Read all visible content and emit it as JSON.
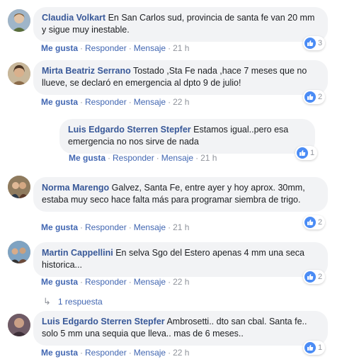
{
  "comments": [
    {
      "author": "Claudia Volkart",
      "text": "En San Carlos sud, provincia de santa fe van 20 mm y sigue muy inestable.",
      "like": "Me gusta",
      "reply": "Responder",
      "message": "Mensaje",
      "time": "21 h",
      "reactions": "3"
    },
    {
      "author": "Mirta Beatriz Serrano",
      "text": "Tostado ,Sta Fe nada ,hace 7 meses que no llueve, se declaró en emergencia al dpto 9 de julio!",
      "like": "Me gusta",
      "reply": "Responder",
      "message": "Mensaje",
      "time": "22 h",
      "reactions": "2"
    },
    {
      "author": "Luis Edgardo Sterren Stepfer",
      "text": "Estamos igual..pero esa emergencia no nos sirve de nada",
      "like": "Me gusta",
      "reply": "Responder",
      "message": "Mensaje",
      "time": "21 h",
      "reactions": "1"
    },
    {
      "author": "Norma Marengo",
      "text": "Galvez, Santa Fe, entre ayer y hoy aprox. 30mm, estaba muy seco hace falta más para programar siembra de trigo.",
      "like": "Me gusta",
      "reply": "Responder",
      "message": "Mensaje",
      "time": "21 h",
      "reactions": "2"
    },
    {
      "author": "Martin Cappellini",
      "text": "En selva Sgo del Estero apenas 4 mm una seca historica...",
      "like": "Me gusta",
      "reply": "Responder",
      "message": "Mensaje",
      "time": "22 h",
      "reactions": "2",
      "replies_label": "1 respuesta"
    },
    {
      "author": "Luis Edgardo Sterren Stepfer",
      "text": "Ambrosetti.. dto san cbal. Santa fe.. solo 5 mm una sequia que lleva.. mas de 6 meses..",
      "like": "Me gusta",
      "reply": "Responder",
      "message": "Mensaje",
      "time": "22 h",
      "reactions": "1"
    }
  ],
  "colors": {
    "author": "#385898",
    "action": "#4267b2",
    "bubble": "#f2f3f5",
    "meta": "#90949c",
    "like_badge": "#4b8cf5"
  },
  "icons": {
    "reaction": "like-icon",
    "replies": "reply-arrow-icon"
  }
}
